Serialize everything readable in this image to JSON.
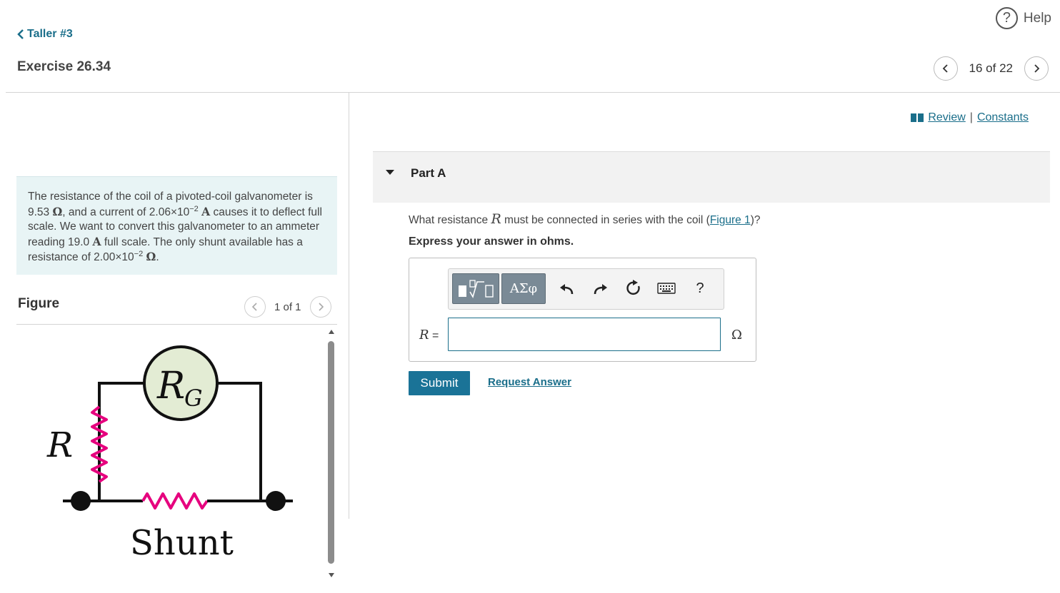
{
  "header": {
    "help_label": "Help",
    "help_icon": "question-circle-icon",
    "back_label": "Taller #3",
    "exercise_title": "Exercise 26.34",
    "pager_text": "16 of 22"
  },
  "problem": {
    "t1": "The resistance of the coil of a pivoted-coil galvanometer is 9.53 ",
    "ohm": "Ω",
    "t2": ", and a current of 2.06×10",
    "exp1": "−2",
    "amp": "A",
    "t3": " causes it to deflect full scale. We want to convert this galvanometer to an ammeter reading 19.0 ",
    "t4": " full scale. The only shunt available has a resistance of 2.00×10",
    "exp2": "−2",
    "end": "."
  },
  "figure": {
    "label": "Figure",
    "pager_text": "1 of 1",
    "labels": {
      "galvanometer_main": "R",
      "galvanometer_sub": "G",
      "resistor": "R",
      "shunt": "Shunt"
    },
    "colors": {
      "resistor": "#e6007e",
      "galvanometer_fill": "#e3ecd4",
      "wire": "#111111"
    }
  },
  "resources": {
    "review_label": "Review",
    "separator": "|",
    "constants_label": "Constants"
  },
  "part": {
    "title": "Part A",
    "q1": "What resistance ",
    "q_var": "R",
    "q2": " must be connected in series with the coil (",
    "q_link": "Figure 1",
    "q3": ")?",
    "instruction": "Express your answer in ohms.",
    "greek_label": "ΑΣφ",
    "help_glyph": "?",
    "answer_var": "R",
    "answer_eq": " =",
    "answer_value": "",
    "unit": "Ω",
    "submit_label": "Submit",
    "request_label": "Request Answer"
  }
}
